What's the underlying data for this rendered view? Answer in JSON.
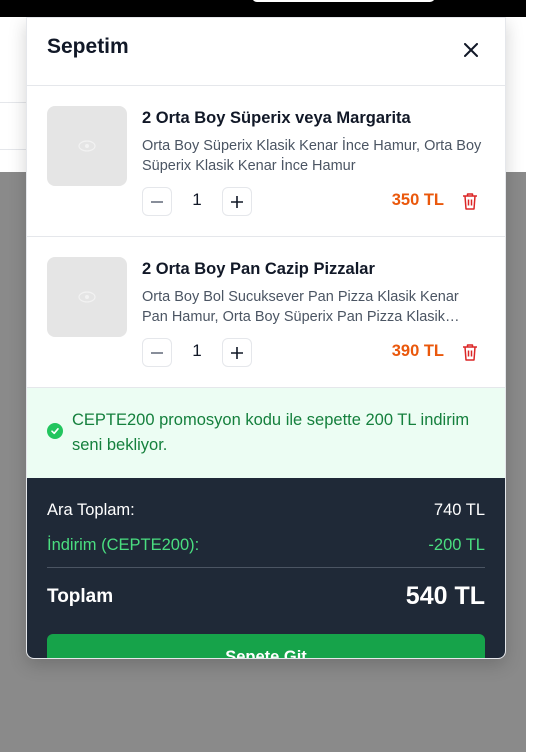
{
  "cart": {
    "title": "Sepetim",
    "close_icon": "close-icon",
    "items": [
      {
        "name": "2 Orta Boy Süperix veya Margarita",
        "description": "Orta Boy Süperix Klasik Kenar İnce Hamur, Orta Boy Süperix Klasik Kenar İnce Hamur",
        "quantity": "1",
        "price": "350 TL",
        "image_placeholder_icon": "image-placeholder-icon"
      },
      {
        "name": "2 Orta Boy Pan Cazip Pizzalar",
        "description": "Orta Boy Bol Sucuksever Pan Pizza Klasik Kenar Pan Hamur, Orta Boy Süperix Pan Pizza Klasik Kenar Pan Hamur",
        "quantity": "1",
        "price": "390 TL",
        "image_placeholder_icon": "image-placeholder-icon"
      }
    ],
    "promo": {
      "text": "CEPTE200 promosyon kodu ile sepette 200 TL indirim seni bekliyor.",
      "icon": "check-circle-icon"
    },
    "summary": {
      "subtotal_label": "Ara Toplam:",
      "subtotal_value": "740 TL",
      "discount_label": "İndirim (CEPTE200):",
      "discount_value": "-200 TL",
      "total_label": "Toplam",
      "total_value": "540 TL",
      "checkout_label": "Sepete Git"
    }
  },
  "colors": {
    "price": "#ea580c",
    "promo_bg": "#ecfdf3",
    "promo_text": "#15803d",
    "summary_bg": "#1f2937",
    "discount": "#4ade80",
    "checkout": "#16a34a"
  }
}
